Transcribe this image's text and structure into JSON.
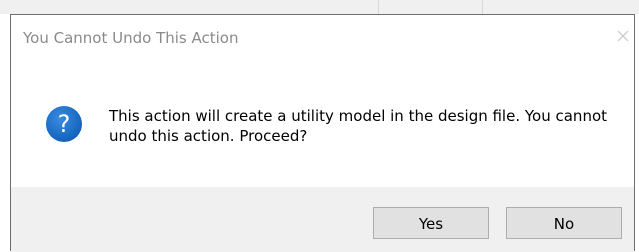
{
  "dialog": {
    "title": "You Cannot Undo This Action",
    "icon": "question-icon",
    "message": "This action will create a utility model in the design file. You cannot undo this action.  Proceed?",
    "buttons": {
      "yes": "Yes",
      "no": "No"
    }
  },
  "colors": {
    "icon_blue": "#1b6fc8",
    "title_gray": "#8a8a8a",
    "footer_bg": "#f0f0f0"
  }
}
